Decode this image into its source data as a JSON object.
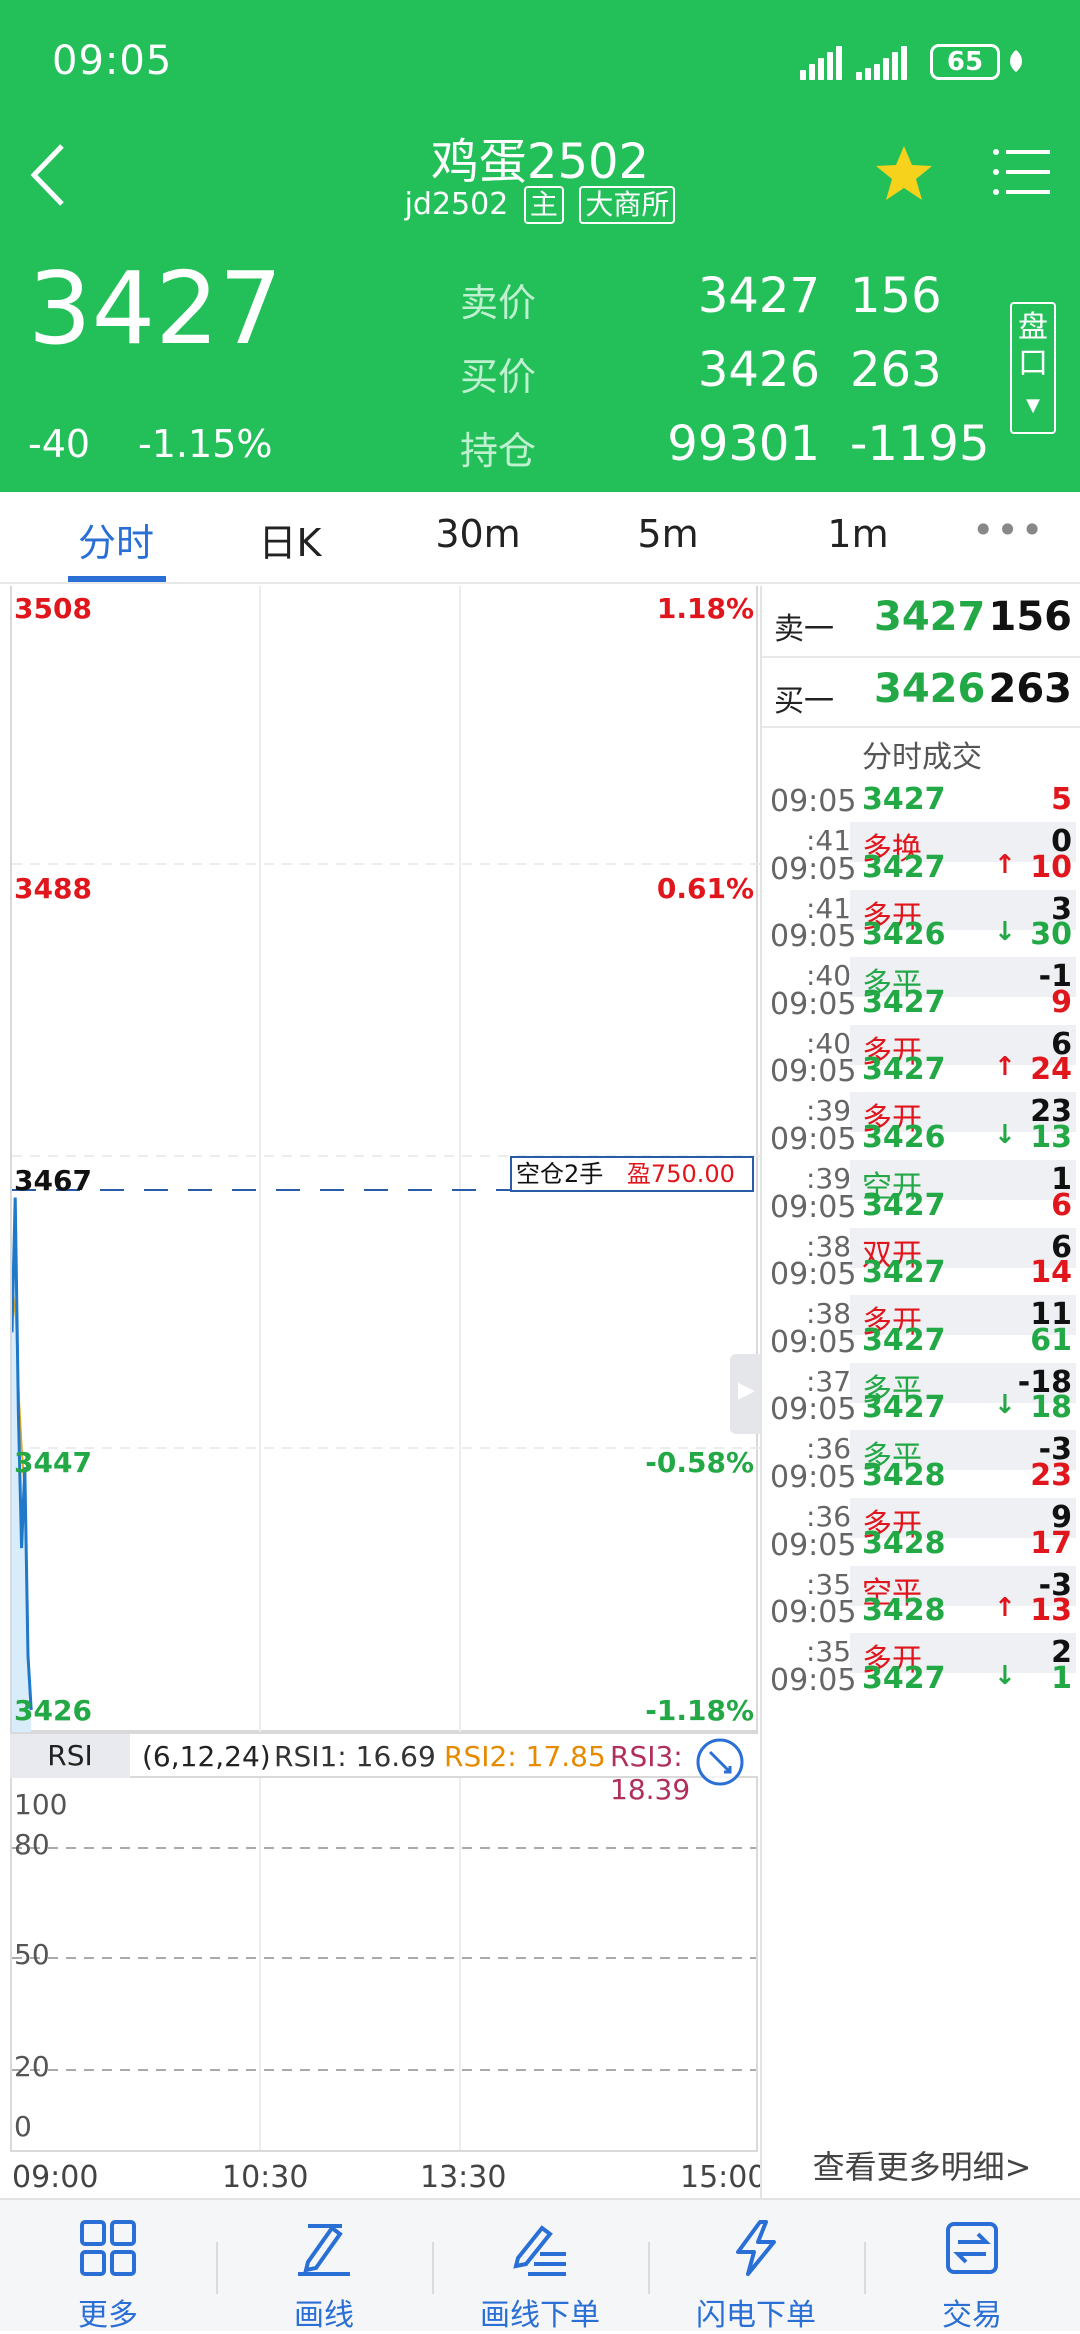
{
  "status": {
    "time": "09:05",
    "battery": "65"
  },
  "header": {
    "title": "鸡蛋2502",
    "code": "jd2502",
    "tag_main": "主",
    "tag_exchange": "大商所",
    "last_price": "3427",
    "change": "-40",
    "change_pct": "-1.15%",
    "quotes": [
      {
        "label": "卖价",
        "v1": "3427",
        "v2": "156"
      },
      {
        "label": "买价",
        "v1": "3426",
        "v2": "263"
      },
      {
        "label": "持仓",
        "v1": "99301",
        "v2": "-1195"
      }
    ],
    "pankou": "盘口"
  },
  "tabs": [
    "分时",
    "日K",
    "30m",
    "5m",
    "1m"
  ],
  "active_tab": "分时",
  "chart": {
    "y_left": [
      "3508",
      "3488",
      "3467",
      "3447",
      "3426"
    ],
    "y_right": [
      "1.18%",
      "0.61%",
      "-0.58%",
      "-1.18%"
    ],
    "position_label": "空仓2手",
    "position_pnl": "盈750.00",
    "x_labels": [
      "09:00",
      "10:30",
      "13:30",
      "15:00"
    ],
    "colors": {
      "price_line": "#1f78c8",
      "avg_line": "#e6a817",
      "up": "#e0161c",
      "down": "#22a845"
    }
  },
  "chart_data": {
    "type": "line",
    "title": "",
    "xlabel": "",
    "ylabel": "",
    "ylim": [
      3426,
      3508
    ],
    "series": [
      {
        "values": [
          3454,
          3464,
          3448,
          3438,
          3444,
          3430,
          3426
        ]
      },
      {
        "values": [
          3457,
          3455,
          3449,
          3445,
          3442
        ]
      }
    ]
  },
  "rsi": {
    "tag": "RSI",
    "params": "(6,12,24)",
    "rsi1": "RSI1: 16.69",
    "rsi2": "RSI2: 17.85",
    "rsi3": "RSI3: 18.39",
    "levels": [
      "100",
      "80",
      "50",
      "20",
      "0"
    ]
  },
  "orderbook": [
    {
      "label": "卖一",
      "price": "3427",
      "qty": "156"
    },
    {
      "label": "买一",
      "price": "3426",
      "qty": "263"
    }
  ],
  "trades_title": "分时成交",
  "trades": [
    {
      "t1": "09:05",
      "t2": ":41",
      "price": "3427",
      "arrow": "",
      "vol": "5",
      "kind": "多换",
      "oi": "0",
      "price_color": "g",
      "vol_color": "r",
      "kind_color": "r"
    },
    {
      "t1": "09:05",
      "t2": ":41",
      "price": "3427",
      "arrow": "↑",
      "vol": "10",
      "kind": "多开",
      "oi": "3",
      "price_color": "g",
      "vol_color": "r",
      "kind_color": "r"
    },
    {
      "t1": "09:05",
      "t2": ":40",
      "price": "3426",
      "arrow": "↓",
      "vol": "30",
      "kind": "多平",
      "oi": "-1",
      "price_color": "g",
      "vol_color": "g",
      "kind_color": "g"
    },
    {
      "t1": "09:05",
      "t2": ":40",
      "price": "3427",
      "arrow": "",
      "vol": "9",
      "kind": "多开",
      "oi": "6",
      "price_color": "g",
      "vol_color": "r",
      "kind_color": "r"
    },
    {
      "t1": "09:05",
      "t2": ":39",
      "price": "3427",
      "arrow": "↑",
      "vol": "24",
      "kind": "多开",
      "oi": "23",
      "price_color": "g",
      "vol_color": "r",
      "kind_color": "r"
    },
    {
      "t1": "09:05",
      "t2": ":39",
      "price": "3426",
      "arrow": "↓",
      "vol": "13",
      "kind": "空开",
      "oi": "1",
      "price_color": "g",
      "vol_color": "g",
      "kind_color": "g"
    },
    {
      "t1": "09:05",
      "t2": ":38",
      "price": "3427",
      "arrow": "",
      "vol": "6",
      "kind": "双开",
      "oi": "6",
      "price_color": "g",
      "vol_color": "r",
      "kind_color": "r"
    },
    {
      "t1": "09:05",
      "t2": ":38",
      "price": "3427",
      "arrow": "",
      "vol": "14",
      "kind": "多开",
      "oi": "11",
      "price_color": "g",
      "vol_color": "r",
      "kind_color": "r"
    },
    {
      "t1": "09:05",
      "t2": ":37",
      "price": "3427",
      "arrow": "",
      "vol": "61",
      "kind": "多平",
      "oi": "-18",
      "price_color": "g",
      "vol_color": "g",
      "kind_color": "g"
    },
    {
      "t1": "09:05",
      "t2": ":36",
      "price": "3427",
      "arrow": "↓",
      "vol": "18",
      "kind": "多平",
      "oi": "-3",
      "price_color": "g",
      "vol_color": "g",
      "kind_color": "g"
    },
    {
      "t1": "09:05",
      "t2": ":36",
      "price": "3428",
      "arrow": "",
      "vol": "23",
      "kind": "多开",
      "oi": "9",
      "price_color": "g",
      "vol_color": "r",
      "kind_color": "r"
    },
    {
      "t1": "09:05",
      "t2": ":35",
      "price": "3428",
      "arrow": "",
      "vol": "17",
      "kind": "空平",
      "oi": "-3",
      "price_color": "g",
      "vol_color": "r",
      "kind_color": "r"
    },
    {
      "t1": "09:05",
      "t2": ":35",
      "price": "3428",
      "arrow": "↑",
      "vol": "13",
      "kind": "多开",
      "oi": "2",
      "price_color": "g",
      "vol_color": "r",
      "kind_color": "r"
    },
    {
      "t1": "09:05",
      "t2": "",
      "price": "3427",
      "arrow": "↓",
      "vol": "1",
      "kind": "",
      "oi": "",
      "price_color": "g",
      "vol_color": "g",
      "kind_color": "g"
    }
  ],
  "more_detail": "查看更多明细>",
  "bottom_nav": [
    {
      "label": "更多",
      "icon": "grid-icon"
    },
    {
      "label": "画线",
      "icon": "draw-line-icon"
    },
    {
      "label": "画线下单",
      "icon": "draw-order-icon"
    },
    {
      "label": "闪电下单",
      "icon": "lightning-icon"
    },
    {
      "label": "交易",
      "icon": "trade-icon"
    }
  ]
}
